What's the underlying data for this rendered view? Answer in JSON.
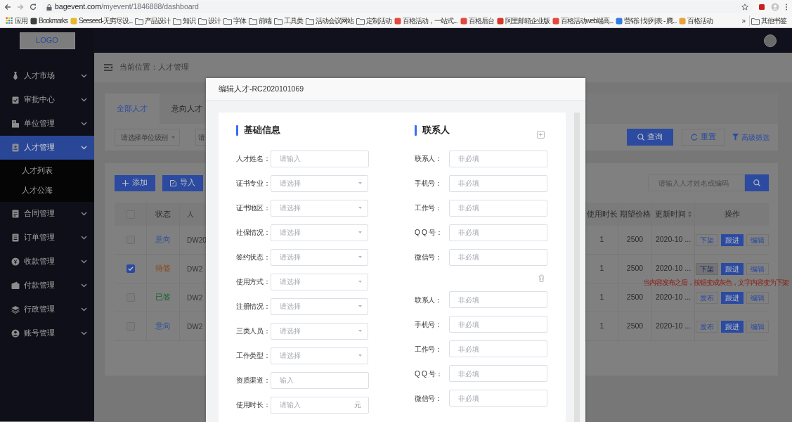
{
  "browser": {
    "url_host": "bagevent.com",
    "url_path": "/myevent/1846888/dashboard",
    "bookmarks": [
      {
        "label": "应用",
        "kind": "apps"
      },
      {
        "label": "Bookmarks",
        "kind": "site",
        "color": "#3c4043"
      },
      {
        "label": "Seeseed-无穷尽设...",
        "kind": "site",
        "color": "#e8b92f"
      },
      {
        "label": "产品设计",
        "kind": "folder"
      },
      {
        "label": "知识",
        "kind": "folder"
      },
      {
        "label": "设计",
        "kind": "folder"
      },
      {
        "label": "字体",
        "kind": "folder"
      },
      {
        "label": "前端",
        "kind": "folder"
      },
      {
        "label": "工具类",
        "kind": "folder"
      },
      {
        "label": "活动会议网站",
        "kind": "folder"
      },
      {
        "label": "定制活动",
        "kind": "folder"
      },
      {
        "label": "百格活动，一站式...",
        "kind": "site",
        "color": "#e5483d"
      },
      {
        "label": "百格后台",
        "kind": "site",
        "color": "#e5483d"
      },
      {
        "label": "阿里邮箱企业版",
        "kind": "site",
        "color": "#d8362b"
      },
      {
        "label": "百格活动web端高...",
        "kind": "site",
        "color": "#e5483d"
      },
      {
        "label": "营销计划列表 - 腾...",
        "kind": "site",
        "color": "#2f7de1"
      },
      {
        "label": "百格活动",
        "kind": "site",
        "color": "#e9a23b"
      }
    ],
    "more": "»",
    "other_bookmarks": "其他书签"
  },
  "sidebar": {
    "logo": "LOGO",
    "items": [
      {
        "label": "人才市场",
        "selected": false
      },
      {
        "label": "审批中心",
        "selected": false
      },
      {
        "label": "单位管理",
        "selected": false
      },
      {
        "label": "人才管理",
        "selected": true,
        "children": [
          {
            "label": "人才列表"
          },
          {
            "label": "人才公海"
          }
        ]
      },
      {
        "label": "合同管理",
        "selected": false
      },
      {
        "label": "订单管理",
        "selected": false
      },
      {
        "label": "收款管理",
        "selected": false
      },
      {
        "label": "付款管理",
        "selected": false
      },
      {
        "label": "行政管理",
        "selected": false
      },
      {
        "label": "账号管理",
        "selected": false
      }
    ]
  },
  "breadcrumb": "当前位置：人才管理",
  "tabs": [
    {
      "label": "全部人才",
      "selected": true
    },
    {
      "label": "意向人才",
      "selected": false
    }
  ],
  "filters": [
    {
      "placeholder": "请选择单位级别"
    },
    {
      "placeholder": "请"
    }
  ],
  "filter_actions": {
    "search": "查询",
    "reset": "重置",
    "advanced": "高级筛选"
  },
  "toolbar": {
    "add": "添加",
    "import": "导入",
    "search_placeholder": "请输入人才姓名或编码"
  },
  "table": {
    "header_checked": false,
    "columns_left": [
      "状态",
      "人"
    ],
    "columns_right": [
      {
        "label": "使用时长",
        "sortable": false
      },
      {
        "label": "期望价格",
        "sortable": false
      },
      {
        "label": "更新时间",
        "sortable": true
      },
      {
        "label": "操作",
        "sortable": false
      }
    ],
    "rows": [
      {
        "checked": false,
        "status": {
          "text": "意向",
          "color": "#2c4c9c"
        },
        "column_3": "DW20",
        "duration": "1",
        "price": "2500",
        "updated": "2020-10 ...",
        "actions": [
          {
            "label": "下架",
            "kind": "outline"
          },
          {
            "label": "跟进",
            "kind": "primary"
          },
          {
            "label": "编辑",
            "kind": "outline"
          }
        ]
      },
      {
        "checked": true,
        "status": {
          "text": "待签",
          "color": "#8a4510"
        },
        "column_3": "DW2",
        "duration": "1",
        "price": "2500",
        "updated": "2020-10 ...",
        "actions": [
          {
            "label": "下架",
            "kind": "disabled"
          },
          {
            "label": "跟进",
            "kind": "primary"
          },
          {
            "label": "编辑",
            "kind": "outline"
          }
        ],
        "note": "当内容发布之后，按钮变成灰色，文字内容变为下架"
      },
      {
        "checked": false,
        "status": {
          "text": "已签",
          "color": "#17632e"
        },
        "column_3": "DW2",
        "duration": "1",
        "price": "2500",
        "updated": "2020-10 ...",
        "actions": [
          {
            "label": "发布",
            "kind": "outline"
          },
          {
            "label": "跟进",
            "kind": "primary"
          },
          {
            "label": "编辑",
            "kind": "outline"
          }
        ]
      },
      {
        "checked": false,
        "status": {
          "text": "意向",
          "color": "#2c4c9c"
        },
        "column_3": "DW2",
        "duration": "1",
        "price": "2500",
        "updated": "2020-10 ...",
        "actions": [
          {
            "label": "发布",
            "kind": "outline"
          },
          {
            "label": "跟进",
            "kind": "primary"
          },
          {
            "label": "编辑",
            "kind": "outline"
          }
        ]
      }
    ]
  },
  "modal": {
    "title": "编辑人才-RC2020101069",
    "basic": {
      "title": "基础信息",
      "fields": [
        {
          "label": "人才姓名：",
          "kind": "input",
          "placeholder": "请输入"
        },
        {
          "label": "证书专业：",
          "kind": "select",
          "placeholder": "请选择"
        },
        {
          "label": "证书地区：",
          "kind": "select",
          "placeholder": "请选择"
        },
        {
          "label": "社保情况：",
          "kind": "select",
          "placeholder": "请选择"
        },
        {
          "label": "签约状态：",
          "kind": "select",
          "placeholder": "请选择"
        },
        {
          "label": "使用方式：",
          "kind": "select",
          "placeholder": "请选择"
        },
        {
          "label": "注册情况：",
          "kind": "select",
          "placeholder": "请选择"
        },
        {
          "label": "三类人员：",
          "kind": "select",
          "placeholder": "请选择"
        },
        {
          "label": "工作类型：",
          "kind": "select",
          "placeholder": "请选择"
        },
        {
          "label": "资质渠道：",
          "kind": "input",
          "placeholder": "输入"
        },
        {
          "label": "使用时长：",
          "kind": "suffix",
          "placeholder": "请输入",
          "suffix": "元"
        }
      ]
    },
    "contacts": {
      "title": "联系人",
      "groups": [
        {
          "removable": false,
          "fields": [
            {
              "label": "联系人：",
              "placeholder": "非必填"
            },
            {
              "label": "手机号：",
              "placeholder": "非必填"
            },
            {
              "label": "工作号：",
              "placeholder": "非必填"
            },
            {
              "label": "Q Q 号：",
              "placeholder": "非必填"
            },
            {
              "label": "微信号：",
              "placeholder": "非必填"
            }
          ]
        },
        {
          "removable": true,
          "fields": [
            {
              "label": "联系人：",
              "placeholder": "非必填"
            },
            {
              "label": "手机号：",
              "placeholder": "非必填"
            },
            {
              "label": "工作号：",
              "placeholder": "非必填"
            },
            {
              "label": "Q Q 号：",
              "placeholder": "非必填"
            },
            {
              "label": "微信号：",
              "placeholder": "非必填"
            }
          ]
        }
      ]
    }
  }
}
